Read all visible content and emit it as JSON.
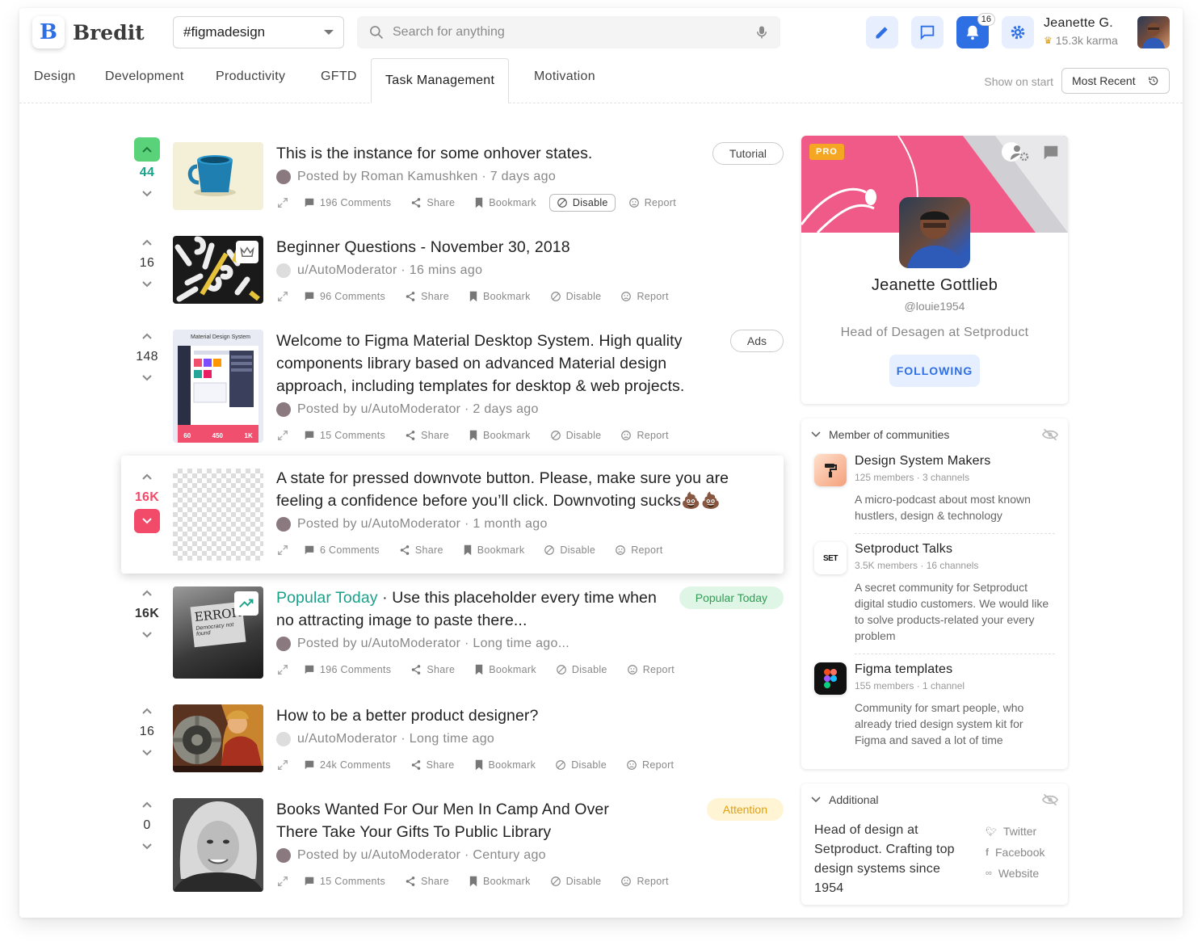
{
  "app": {
    "logo_letter": "B",
    "name": "Bredit"
  },
  "header": {
    "community": "#figmadesign",
    "search_placeholder": "Search for anything",
    "notifications_count": "16",
    "user_name": "Jeanette G.",
    "user_karma": "15.3k karma"
  },
  "tabs": [
    "Design",
    "Development",
    "Productivity",
    "GFTD",
    "Task Management",
    "Motivation"
  ],
  "sort": {
    "show_on_start": "Show on start",
    "selected": "Most Recent"
  },
  "actions": {
    "share": "Share",
    "bookmark": "Bookmark",
    "disable": "Disable",
    "report": "Report"
  },
  "posts": [
    {
      "votes": "44",
      "title": "This is the instance for some onhover states.",
      "meta": "Posted by Roman Kamushken · 7 days ago",
      "comments": "196 Comments",
      "badge": "Tutorial"
    },
    {
      "votes": "16",
      "title": "Beginner Questions - November 30, 2018",
      "meta": "u/AutoModerator · 16 mins ago",
      "comments": "96 Comments",
      "badge": ""
    },
    {
      "votes": "148",
      "title": "Welcome to Figma Material Desktop System. High quality components library based on advanced Material design approach, including templates for desktop & web projects.",
      "meta": "Posted by u/AutoModerator · 2 days ago",
      "comments": "15 Comments",
      "badge": "Ads",
      "thumb_title": "Material Design System",
      "thumb_stats": [
        "60",
        "450",
        "1K"
      ]
    },
    {
      "votes": "16K",
      "title": "A state for pressed downvote button. Please, make sure you are feeling a confidence before you’ll click. Downvoting sucks💩💩",
      "meta": "Posted by u/AutoModerator · 1 month ago",
      "comments": "6 Comments",
      "badge": ""
    },
    {
      "votes": "16K",
      "title_highlight": "Popular Today",
      "title": " · Use this placeholder every time when no attracting image to paste there...",
      "meta": "Posted by u/AutoModerator · Long time ago...",
      "comments": "196 Comments",
      "badge": "Popular Today",
      "thumb_text": "ERROR",
      "thumb_subtext": "Democracy not found"
    },
    {
      "votes": "16",
      "title": "How to be a better product designer?",
      "meta": "u/AutoModerator · Long time ago",
      "comments": "24k Comments",
      "badge": ""
    },
    {
      "votes": "0",
      "title": "Books Wanted For Our Men In Camp And Over There Take Your Gifts To Public Library",
      "meta": "Posted by u/AutoModerator · Century ago",
      "comments": "15 Comments",
      "badge": "Attention"
    }
  ],
  "profile": {
    "pro": "PRO",
    "name": "Jeanette Gottlieb",
    "handle": "@louie1954",
    "role": "Head of Desagen at Setproduct",
    "follow": "FOLLOWING"
  },
  "communities": {
    "title": "Member of communities",
    "items": [
      {
        "name": "Design System Makers",
        "stats": "125 members · 3 channels",
        "desc": "A micro-podcast about most known hustlers, design & technology"
      },
      {
        "name": "Setproduct Talks",
        "stats": "3.5K members · 16 channels",
        "desc": "A secret community for Setproduct digital studio customers. We would like to solve products-related your every problem",
        "logo_text": "SET"
      },
      {
        "name": "Figma templates",
        "stats": "155 members · 1 channel",
        "desc": "Community for smart people, who already tried design system kit for Figma and saved a lot of time"
      }
    ]
  },
  "additional": {
    "title": "Additional",
    "desc": "Head of design at Setproduct. Crafting top design systems since 1954",
    "links": [
      "Twitter",
      "Facebook",
      "Website"
    ]
  },
  "colors": {
    "accent": "#2f6fe4",
    "upvote": "#5ad27a",
    "downvote": "#f24b6a",
    "highlight": "#19a18a",
    "pro": "#f5a623"
  }
}
